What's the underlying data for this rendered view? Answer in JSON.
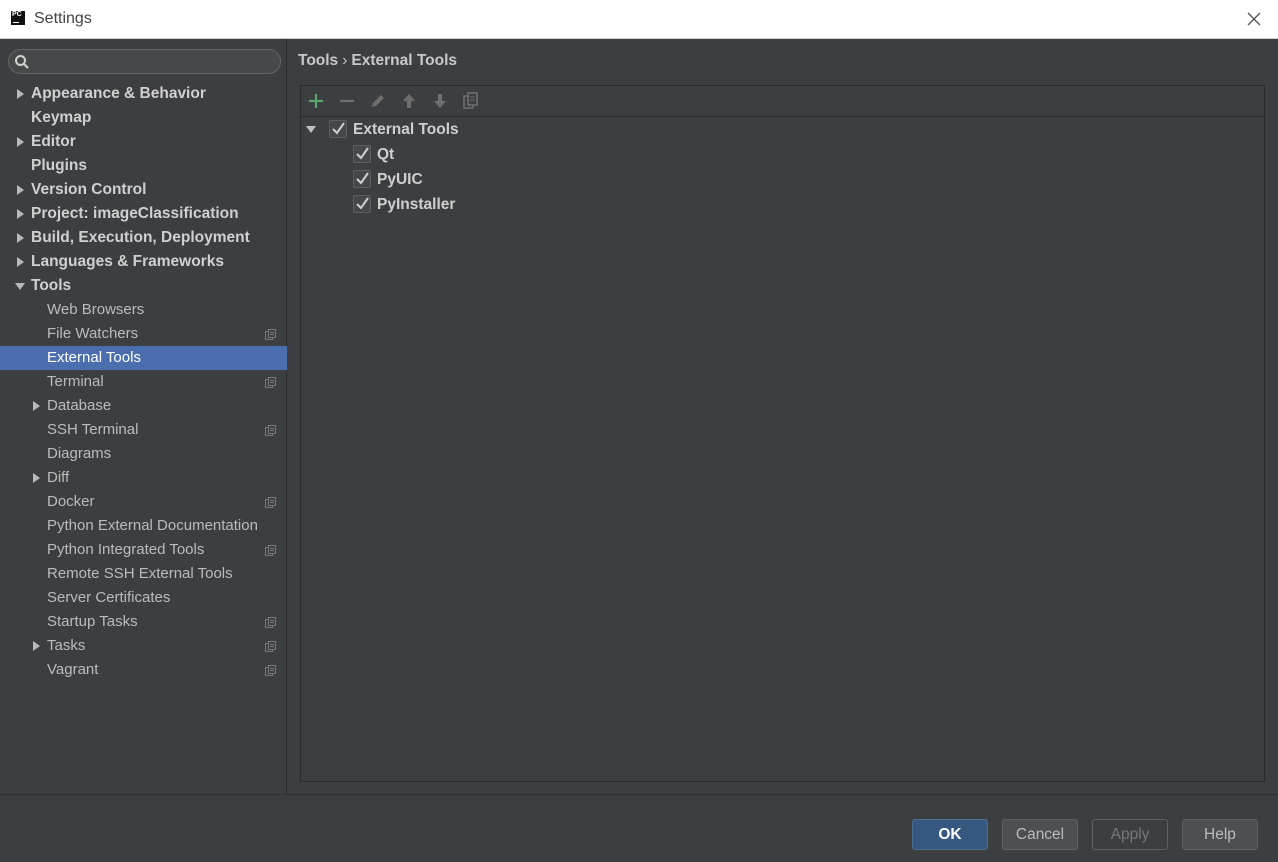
{
  "window": {
    "title": "Settings",
    "app_icon_text": "PC"
  },
  "search": {
    "placeholder": "",
    "value": ""
  },
  "sidebar": {
    "items": [
      {
        "label": "Appearance & Behavior",
        "level": 0,
        "arrow": "collapsed",
        "project_scoped": false
      },
      {
        "label": "Keymap",
        "level": 0,
        "arrow": "none",
        "project_scoped": false
      },
      {
        "label": "Editor",
        "level": 0,
        "arrow": "collapsed",
        "project_scoped": false
      },
      {
        "label": "Plugins",
        "level": 0,
        "arrow": "none",
        "project_scoped": false
      },
      {
        "label": "Version Control",
        "level": 0,
        "arrow": "collapsed",
        "project_scoped": false
      },
      {
        "label": "Project: imageClassification",
        "level": 0,
        "arrow": "collapsed",
        "project_scoped": false
      },
      {
        "label": "Build, Execution, Deployment",
        "level": 0,
        "arrow": "collapsed",
        "project_scoped": false
      },
      {
        "label": "Languages & Frameworks",
        "level": 0,
        "arrow": "collapsed",
        "project_scoped": false
      },
      {
        "label": "Tools",
        "level": 0,
        "arrow": "expanded",
        "project_scoped": false
      },
      {
        "label": "Web Browsers",
        "level": 1,
        "arrow": "none",
        "project_scoped": false
      },
      {
        "label": "File Watchers",
        "level": 1,
        "arrow": "none",
        "project_scoped": true
      },
      {
        "label": "External Tools",
        "level": 1,
        "arrow": "none",
        "project_scoped": false,
        "selected": true
      },
      {
        "label": "Terminal",
        "level": 1,
        "arrow": "none",
        "project_scoped": true
      },
      {
        "label": "Database",
        "level": 1,
        "arrow": "collapsed",
        "project_scoped": false
      },
      {
        "label": "SSH Terminal",
        "level": 1,
        "arrow": "none",
        "project_scoped": true
      },
      {
        "label": "Diagrams",
        "level": 1,
        "arrow": "none",
        "project_scoped": false
      },
      {
        "label": "Diff",
        "level": 1,
        "arrow": "collapsed",
        "project_scoped": false
      },
      {
        "label": "Docker",
        "level": 1,
        "arrow": "none",
        "project_scoped": true
      },
      {
        "label": "Python External Documentation",
        "level": 1,
        "arrow": "none",
        "project_scoped": false
      },
      {
        "label": "Python Integrated Tools",
        "level": 1,
        "arrow": "none",
        "project_scoped": true
      },
      {
        "label": "Remote SSH External Tools",
        "level": 1,
        "arrow": "none",
        "project_scoped": false
      },
      {
        "label": "Server Certificates",
        "level": 1,
        "arrow": "none",
        "project_scoped": false
      },
      {
        "label": "Startup Tasks",
        "level": 1,
        "arrow": "none",
        "project_scoped": true
      },
      {
        "label": "Tasks",
        "level": 1,
        "arrow": "collapsed",
        "project_scoped": true
      },
      {
        "label": "Vagrant",
        "level": 1,
        "arrow": "none",
        "project_scoped": true
      }
    ]
  },
  "main": {
    "breadcrumb": {
      "parent": "Tools",
      "separator": "›",
      "current": "External Tools"
    },
    "toolbar": [
      "add-icon",
      "remove-icon",
      "edit-icon",
      "move-up-icon",
      "move-down-icon",
      "copy-icon"
    ],
    "tools_tree": {
      "group": {
        "label": "External Tools",
        "checked": true,
        "expanded": true
      },
      "items": [
        {
          "label": "Qt",
          "checked": true
        },
        {
          "label": "PyUIC",
          "checked": true
        },
        {
          "label": "PyInstaller",
          "checked": true
        }
      ]
    }
  },
  "footer": {
    "ok": "OK",
    "cancel": "Cancel",
    "apply": "Apply",
    "help": "Help"
  },
  "colors": {
    "background": "#3c3f41",
    "selection": "#4b6eaf",
    "ok_button": "#365880",
    "add_icon": "#59a869"
  }
}
